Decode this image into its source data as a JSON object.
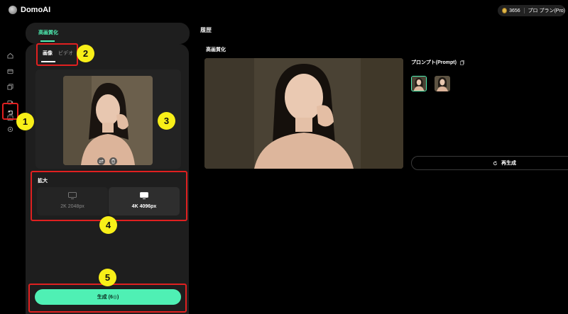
{
  "app": {
    "title": "DomoAI"
  },
  "account": {
    "credits": "3656",
    "plan": "プロ プラン(Pro)"
  },
  "sidebar": {
    "items": [
      {
        "icon": "home-icon"
      },
      {
        "icon": "box-icon"
      },
      {
        "icon": "layers-icon"
      },
      {
        "icon": "video-icon"
      },
      {
        "icon": "image-icon"
      },
      {
        "icon": "upscale-icon",
        "active": true
      },
      {
        "icon": "settings-icon"
      }
    ]
  },
  "tool": {
    "label": "高画質化"
  },
  "tabs": [
    {
      "label": "画像",
      "active": true
    },
    {
      "label": "ビデオ",
      "active": false
    }
  ],
  "upscale": {
    "title": "拡大",
    "options": [
      {
        "label": "2K 2048px",
        "badge": "2K",
        "selected": false
      },
      {
        "label": "4K 4096px",
        "badge": "4K",
        "selected": true
      }
    ]
  },
  "generate": {
    "label": "生成 (6◎)"
  },
  "history": {
    "title": "履歴",
    "result_title": "高画質化",
    "prompt_label": "プロンプト(Prompt)",
    "regenerate_label": "再生成"
  },
  "annotations": [
    "1",
    "2",
    "3",
    "4",
    "5"
  ],
  "colors": {
    "accent": "#4ff0b4",
    "highlight": "#e02020",
    "marker": "#f8ef18"
  }
}
